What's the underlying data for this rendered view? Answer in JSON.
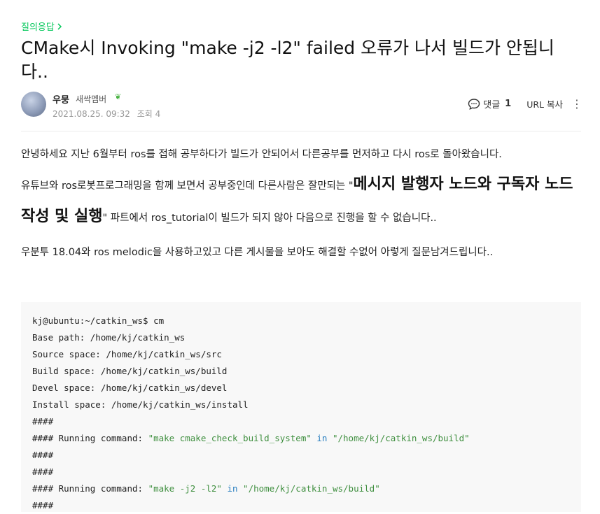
{
  "post": {
    "category": "질의응답",
    "title": "CMake시 Invoking \"make -j2 -l2\" failed 오류가 나서 빌드가 안됩니다..",
    "author": {
      "nickname": "우뭉",
      "grade": "새싹멤버",
      "grade_icon": "sprout-icon"
    },
    "date": "2021.08.25. 09:32",
    "views": "조회 4",
    "comment_label": "댓글",
    "comment_count": "1",
    "url_copy": "URL 복사"
  },
  "content": {
    "p1": "안녕하세요 지난 6월부터 ros를 접해 공부하다가 빌드가 안되어서 다른공부를 먼저하고 다시 ros로 돌아왔습니다.",
    "p2_before": "유튜브와 ros로봇프로그래밍을 함께 보면서 공부중인데 다른사람은 잘만되는 \"",
    "p2_bold": "메시지 발행자 노드와 구독자 노드 작성 및 실행",
    "p2_after": "\" 파트에서 ros_tutorial이 빌드가 되지 않아 다음으로 진행을 할 수 없습니다..",
    "p3": "우분투 18.04와 ros melodic을 사용하고있고 다른 게시물을 보아도 해결할 수없어 아렇게 질문남겨드립니다.."
  },
  "code": {
    "line1": "kj@ubuntu:~/catkin_ws$ cm",
    "line2": "Base path: /home/kj/catkin_ws",
    "line3": "Source space: /home/kj/catkin_ws/src",
    "line4": "Build space: /home/kj/catkin_ws/build",
    "line5": "Devel space: /home/kj/catkin_ws/devel",
    "line6": "Install space: /home/kj/catkin_ws/install",
    "line7": "####",
    "line8_prefix": "#### Running command: ",
    "line8_cmd": "\"make cmake_check_build_system\"",
    "line8_in": " in ",
    "line8_path": "\"/home/kj/catkin_ws/build\"",
    "line9": "####",
    "line10": "####",
    "line11_prefix": "#### Running command: ",
    "line11_cmd": "\"make -j2 -l2\"",
    "line11_in": " in ",
    "line11_path": "\"/home/kj/catkin_ws/build\"",
    "line12": "####"
  },
  "colors": {
    "accent": "#03c75a",
    "code_string": "#3f8f3f",
    "code_keyword": "#2a7fc0"
  }
}
